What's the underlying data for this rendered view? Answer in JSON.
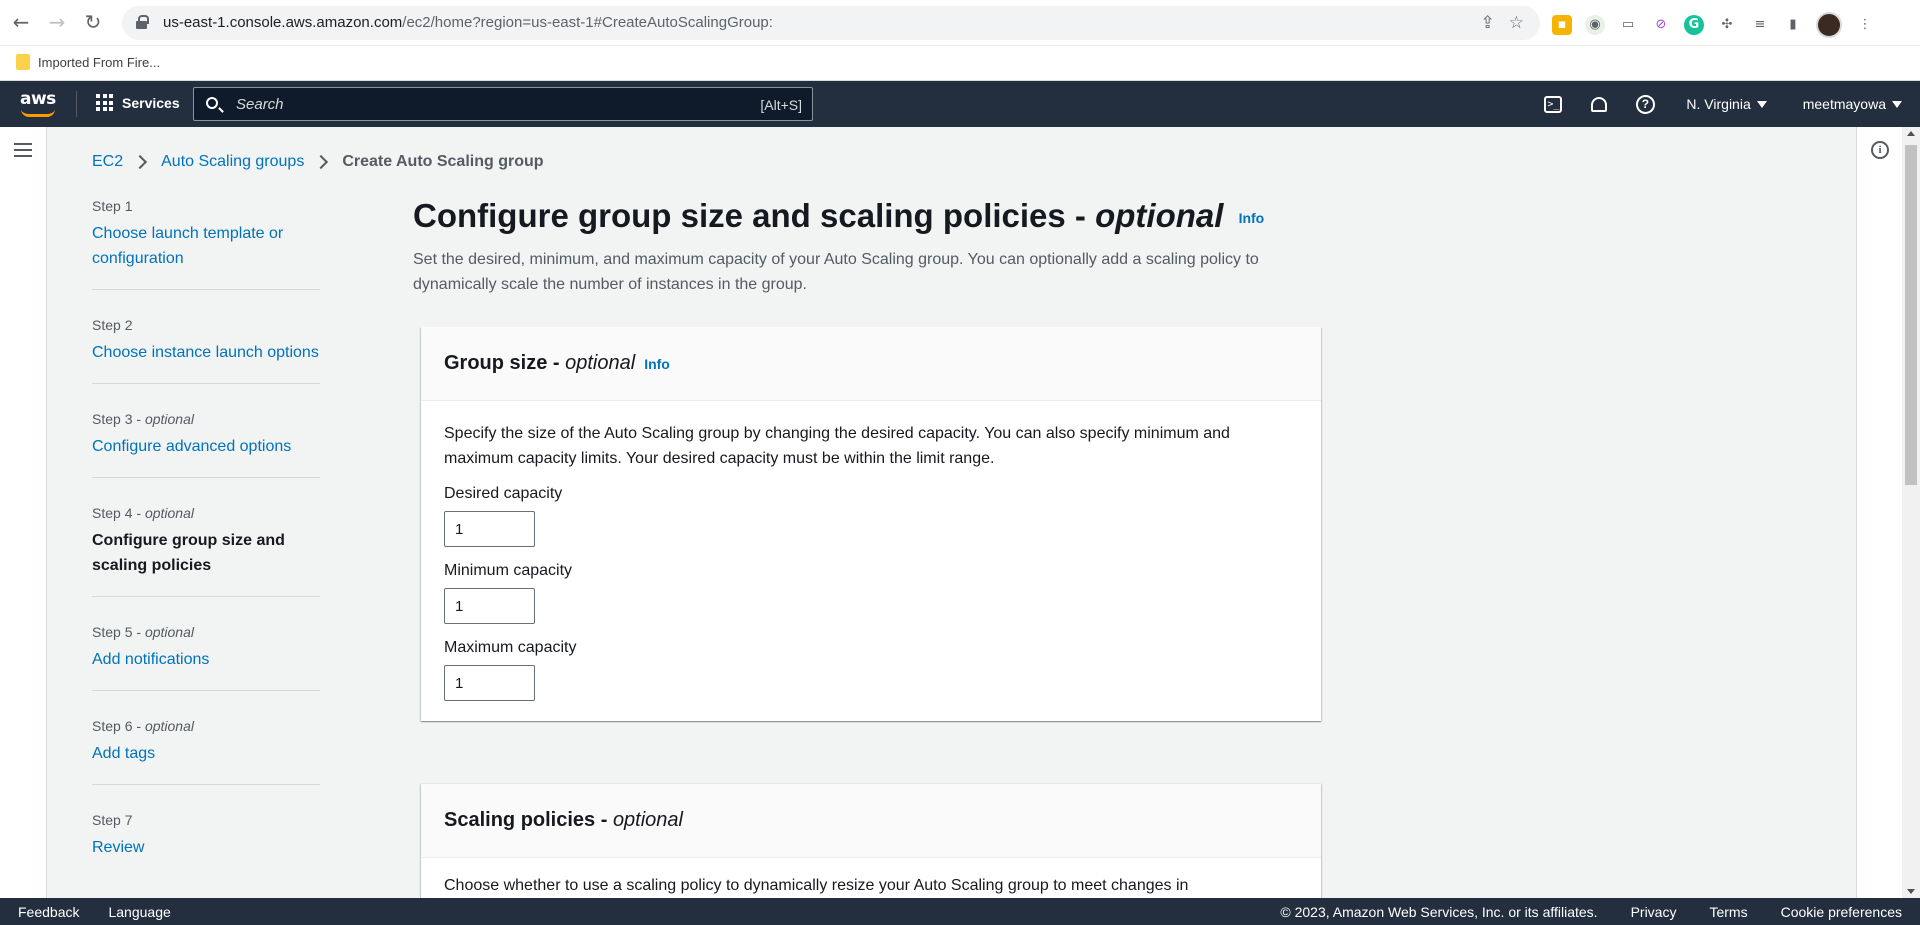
{
  "browser": {
    "url_host": "us-east-1.console.aws.amazon.com",
    "url_path": "/ec2/home?region=us-east-1#CreateAutoScalingGroup:",
    "bookmark": "Imported From Fire..."
  },
  "header": {
    "logo_text": "aws",
    "services_label": "Services",
    "search_placeholder": "Search",
    "search_shortcut": "[Alt+S]",
    "region": "N. Virginia",
    "account": "meetmayowa"
  },
  "breadcrumb": {
    "items": [
      "EC2",
      "Auto Scaling groups"
    ],
    "current": "Create Auto Scaling group"
  },
  "steps": [
    {
      "num": "Step 1",
      "optional": "",
      "title": "Choose launch template or configuration",
      "active": false
    },
    {
      "num": "Step 2",
      "optional": "",
      "title": "Choose instance launch options",
      "active": false
    },
    {
      "num": "Step 3",
      "optional": "optional",
      "title": "Configure advanced options",
      "active": false
    },
    {
      "num": "Step 4",
      "optional": "optional",
      "title": "Configure group size and scaling policies",
      "active": true
    },
    {
      "num": "Step 5",
      "optional": "optional",
      "title": "Add notifications",
      "active": false
    },
    {
      "num": "Step 6",
      "optional": "optional",
      "title": "Add tags",
      "active": false
    },
    {
      "num": "Step 7",
      "optional": "",
      "title": "Review",
      "active": false
    }
  ],
  "main": {
    "title": "Configure group size and scaling policies - ",
    "title_optional": "optional",
    "info": "Info",
    "description": "Set the desired, minimum, and maximum capacity of your Auto Scaling group. You can optionally add a scaling policy to dynamically scale the number of instances in the group."
  },
  "group_size": {
    "title": "Group size - ",
    "title_optional": "optional",
    "info": "Info",
    "description": "Specify the size of the Auto Scaling group by changing the desired capacity. You can also specify minimum and maximum capacity limits. Your desired capacity must be within the limit range.",
    "desired_label": "Desired capacity",
    "desired_value": "1",
    "min_label": "Minimum capacity",
    "min_value": "1",
    "max_label": "Maximum capacity",
    "max_value": "1"
  },
  "scaling_policies": {
    "title": "Scaling policies - ",
    "title_optional": "optional",
    "description": "Choose whether to use a scaling policy to dynamically resize your Auto Scaling group to meet changes in"
  },
  "footer": {
    "feedback": "Feedback",
    "language": "Language",
    "copyright": "© 2023, Amazon Web Services, Inc. or its affiliates.",
    "privacy": "Privacy",
    "terms": "Terms",
    "cookies": "Cookie preferences"
  },
  "colors": {
    "header_bg": "#232f3e",
    "link": "#0073bb",
    "accent": "#ff9900"
  }
}
